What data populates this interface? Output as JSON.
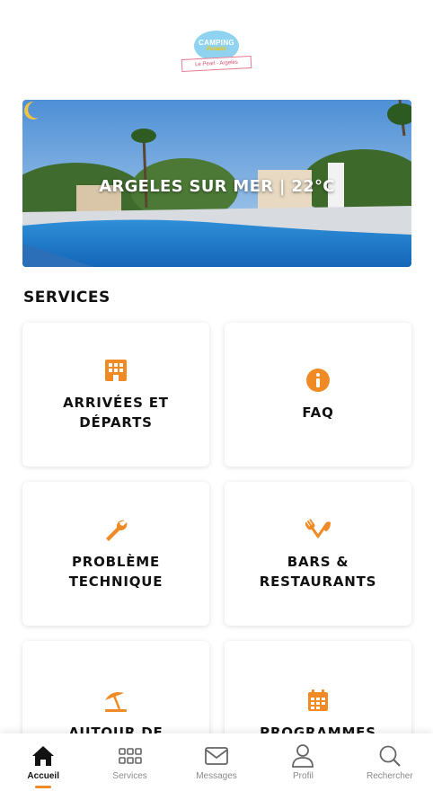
{
  "brand": {
    "name_line1": "CAMPING",
    "name_line2": "Paradis",
    "tagline": "Le Pearl - Argelès",
    "colors": {
      "sky": "#8fd3f0",
      "accent": "#f08a24"
    }
  },
  "hero": {
    "title": "ARGELES SUR MER | 22°C",
    "weather_icon": "moon-icon"
  },
  "services": {
    "title": "SERVICES",
    "items": [
      {
        "label": "ARRIVÉES ET DÉPARTS",
        "icon": "hotel-building-icon"
      },
      {
        "label": "FAQ",
        "icon": "info-circle-icon"
      },
      {
        "label": "PROBLÈME TECHNIQUE",
        "icon": "wrench-icon"
      },
      {
        "label": "BARS & RESTAURANTS",
        "icon": "fork-knife-icon"
      },
      {
        "label": "AUTOUR DE",
        "icon": "beach-umbrella-icon"
      },
      {
        "label": "PROGRAMMES",
        "icon": "calendar-icon"
      }
    ]
  },
  "tabbar": {
    "active": "Accueil",
    "tabs": [
      {
        "label": "Accueil",
        "icon": "home-icon"
      },
      {
        "label": "Services",
        "icon": "grid-icon"
      },
      {
        "label": "Messages",
        "icon": "envelope-icon"
      },
      {
        "label": "Profil",
        "icon": "user-icon"
      },
      {
        "label": "Rechercher",
        "icon": "search-icon"
      }
    ]
  }
}
